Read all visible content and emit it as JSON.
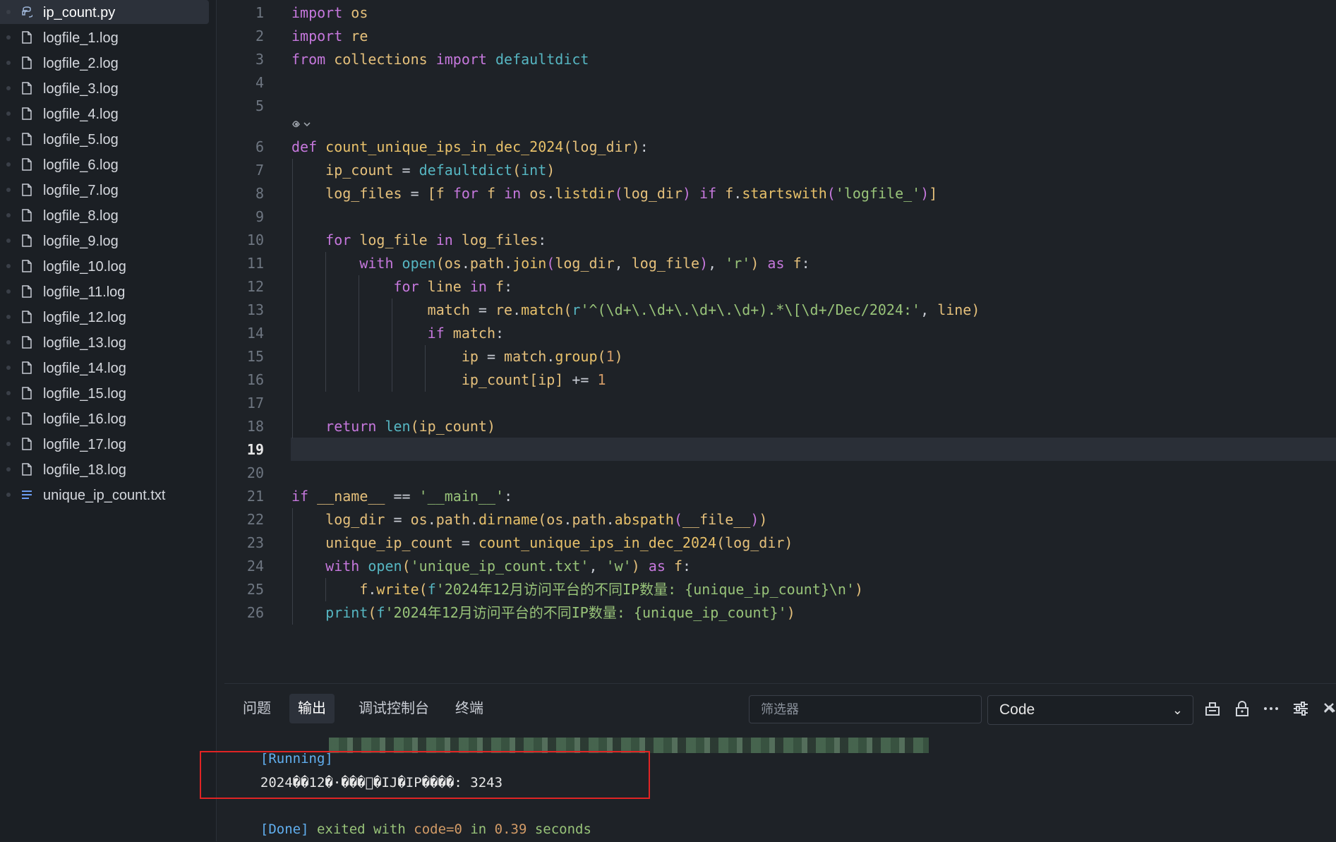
{
  "sidebar": {
    "files": [
      {
        "name": "ip_count.py",
        "type": "python",
        "active": true
      },
      {
        "name": "logfile_1.log",
        "type": "log"
      },
      {
        "name": "logfile_2.log",
        "type": "log"
      },
      {
        "name": "logfile_3.log",
        "type": "log"
      },
      {
        "name": "logfile_4.log",
        "type": "log"
      },
      {
        "name": "logfile_5.log",
        "type": "log"
      },
      {
        "name": "logfile_6.log",
        "type": "log"
      },
      {
        "name": "logfile_7.log",
        "type": "log"
      },
      {
        "name": "logfile_8.log",
        "type": "log"
      },
      {
        "name": "logfile_9.log",
        "type": "log"
      },
      {
        "name": "logfile_10.log",
        "type": "log"
      },
      {
        "name": "logfile_11.log",
        "type": "log"
      },
      {
        "name": "logfile_12.log",
        "type": "log"
      },
      {
        "name": "logfile_13.log",
        "type": "log"
      },
      {
        "name": "logfile_14.log",
        "type": "log"
      },
      {
        "name": "logfile_15.log",
        "type": "log"
      },
      {
        "name": "logfile_16.log",
        "type": "log"
      },
      {
        "name": "logfile_17.log",
        "type": "log"
      },
      {
        "name": "logfile_18.log",
        "type": "log"
      },
      {
        "name": "unique_ip_count.txt",
        "type": "text"
      }
    ]
  },
  "editor": {
    "current_line": 19,
    "lines": [
      {
        "n": "1",
        "code": "import os"
      },
      {
        "n": "2",
        "code": "import re"
      },
      {
        "n": "3",
        "code": "from collections import defaultdict"
      },
      {
        "n": "4",
        "code": ""
      },
      {
        "n": "5",
        "code": ""
      },
      {
        "n": "6",
        "code": "def count_unique_ips_in_dec_2024(log_dir):"
      },
      {
        "n": "7",
        "code": "    ip_count = defaultdict(int)"
      },
      {
        "n": "8",
        "code": "    log_files = [f for f in os.listdir(log_dir) if f.startswith('logfile_')]"
      },
      {
        "n": "9",
        "code": ""
      },
      {
        "n": "10",
        "code": "    for log_file in log_files:"
      },
      {
        "n": "11",
        "code": "        with open(os.path.join(log_dir, log_file), 'r') as f:"
      },
      {
        "n": "12",
        "code": "            for line in f:"
      },
      {
        "n": "13",
        "code": "                match = re.match(r'^(\\d+\\.\\d+\\.\\d+\\.\\d+).*\\[\\d+/Dec/2024:', line)"
      },
      {
        "n": "14",
        "code": "                if match:"
      },
      {
        "n": "15",
        "code": "                    ip = match.group(1)"
      },
      {
        "n": "16",
        "code": "                    ip_count[ip] += 1"
      },
      {
        "n": "17",
        "code": ""
      },
      {
        "n": "18",
        "code": "    return len(ip_count)"
      },
      {
        "n": "19",
        "code": ""
      },
      {
        "n": "20",
        "code": ""
      },
      {
        "n": "21",
        "code": "if __name__ == '__main__':"
      },
      {
        "n": "22",
        "code": "    log_dir = os.path.dirname(os.path.abspath(__file__))"
      },
      {
        "n": "23",
        "code": "    unique_ip_count = count_unique_ips_in_dec_2024(log_dir)"
      },
      {
        "n": "24",
        "code": "    with open('unique_ip_count.txt', 'w') as f:"
      },
      {
        "n": "25",
        "code": "        f.write(f'2024年12月访问平台的不同IP数量: {unique_ip_count}\\n')"
      },
      {
        "n": "26",
        "code": "    print(f'2024年12月访问平台的不同IP数量: {unique_ip_count}')"
      }
    ]
  },
  "panel": {
    "tabs": [
      {
        "label": "问题",
        "active": false
      },
      {
        "label": "输出",
        "active": true
      },
      {
        "label": "调试控制台",
        "active": false
      },
      {
        "label": "终端",
        "active": false
      }
    ],
    "filter_placeholder": "筛选器",
    "channel": "Code",
    "output": {
      "running_tag": "[Running]",
      "result_line": "2024��12�·���ͬ�IJ�IP����: 3243",
      "done_tag": "[Done]",
      "done_text": " exited with ",
      "code_text": "code=0",
      "in_text": " in ",
      "time_value": "0.39",
      "seconds_text": " seconds"
    }
  }
}
